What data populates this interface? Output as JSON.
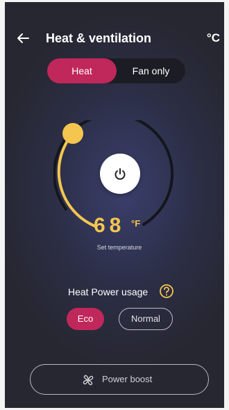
{
  "header": {
    "title": "Heat & ventilation",
    "unit_toggle": "°C",
    "back_icon": "arrow-left-icon"
  },
  "mode_toggle": {
    "options": [
      "Heat",
      "Fan only"
    ],
    "selected": "Heat"
  },
  "thermostat": {
    "temperature": "68",
    "unit": "°F",
    "label": "Set temperature",
    "power_icon": "power-icon"
  },
  "power_usage": {
    "label": "Heat Power usage",
    "help_icon": "question-circle-icon",
    "options": [
      "Eco",
      "Normal"
    ],
    "selected": "Eco"
  },
  "power_boost": {
    "label": "Power boost",
    "icon": "fan-icon"
  },
  "colors": {
    "accent_pink": "#c0275a",
    "accent_yellow": "#f5c64f",
    "background_dark": "#2c2e46"
  }
}
